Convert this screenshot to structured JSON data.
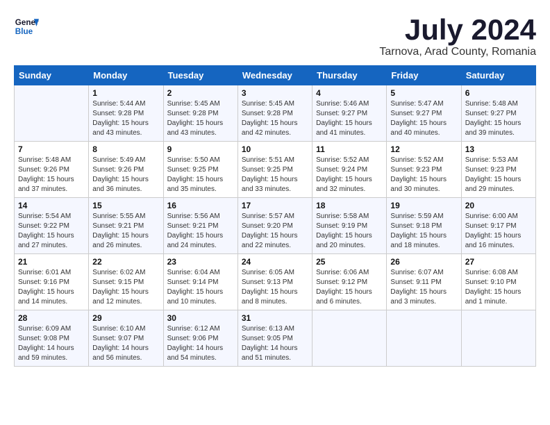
{
  "logo": {
    "line1": "General",
    "line2": "Blue"
  },
  "title": "July 2024",
  "subtitle": "Tarnova, Arad County, Romania",
  "days_header": [
    "Sunday",
    "Monday",
    "Tuesday",
    "Wednesday",
    "Thursday",
    "Friday",
    "Saturday"
  ],
  "weeks": [
    [
      {
        "day": "",
        "sunrise": "",
        "sunset": "",
        "daylight": ""
      },
      {
        "day": "1",
        "sunrise": "Sunrise: 5:44 AM",
        "sunset": "Sunset: 9:28 PM",
        "daylight": "Daylight: 15 hours and 43 minutes."
      },
      {
        "day": "2",
        "sunrise": "Sunrise: 5:45 AM",
        "sunset": "Sunset: 9:28 PM",
        "daylight": "Daylight: 15 hours and 43 minutes."
      },
      {
        "day": "3",
        "sunrise": "Sunrise: 5:45 AM",
        "sunset": "Sunset: 9:28 PM",
        "daylight": "Daylight: 15 hours and 42 minutes."
      },
      {
        "day": "4",
        "sunrise": "Sunrise: 5:46 AM",
        "sunset": "Sunset: 9:27 PM",
        "daylight": "Daylight: 15 hours and 41 minutes."
      },
      {
        "day": "5",
        "sunrise": "Sunrise: 5:47 AM",
        "sunset": "Sunset: 9:27 PM",
        "daylight": "Daylight: 15 hours and 40 minutes."
      },
      {
        "day": "6",
        "sunrise": "Sunrise: 5:48 AM",
        "sunset": "Sunset: 9:27 PM",
        "daylight": "Daylight: 15 hours and 39 minutes."
      }
    ],
    [
      {
        "day": "7",
        "sunrise": "Sunrise: 5:48 AM",
        "sunset": "Sunset: 9:26 PM",
        "daylight": "Daylight: 15 hours and 37 minutes."
      },
      {
        "day": "8",
        "sunrise": "Sunrise: 5:49 AM",
        "sunset": "Sunset: 9:26 PM",
        "daylight": "Daylight: 15 hours and 36 minutes."
      },
      {
        "day": "9",
        "sunrise": "Sunrise: 5:50 AM",
        "sunset": "Sunset: 9:25 PM",
        "daylight": "Daylight: 15 hours and 35 minutes."
      },
      {
        "day": "10",
        "sunrise": "Sunrise: 5:51 AM",
        "sunset": "Sunset: 9:25 PM",
        "daylight": "Daylight: 15 hours and 33 minutes."
      },
      {
        "day": "11",
        "sunrise": "Sunrise: 5:52 AM",
        "sunset": "Sunset: 9:24 PM",
        "daylight": "Daylight: 15 hours and 32 minutes."
      },
      {
        "day": "12",
        "sunrise": "Sunrise: 5:52 AM",
        "sunset": "Sunset: 9:23 PM",
        "daylight": "Daylight: 15 hours and 30 minutes."
      },
      {
        "day": "13",
        "sunrise": "Sunrise: 5:53 AM",
        "sunset": "Sunset: 9:23 PM",
        "daylight": "Daylight: 15 hours and 29 minutes."
      }
    ],
    [
      {
        "day": "14",
        "sunrise": "Sunrise: 5:54 AM",
        "sunset": "Sunset: 9:22 PM",
        "daylight": "Daylight: 15 hours and 27 minutes."
      },
      {
        "day": "15",
        "sunrise": "Sunrise: 5:55 AM",
        "sunset": "Sunset: 9:21 PM",
        "daylight": "Daylight: 15 hours and 26 minutes."
      },
      {
        "day": "16",
        "sunrise": "Sunrise: 5:56 AM",
        "sunset": "Sunset: 9:21 PM",
        "daylight": "Daylight: 15 hours and 24 minutes."
      },
      {
        "day": "17",
        "sunrise": "Sunrise: 5:57 AM",
        "sunset": "Sunset: 9:20 PM",
        "daylight": "Daylight: 15 hours and 22 minutes."
      },
      {
        "day": "18",
        "sunrise": "Sunrise: 5:58 AM",
        "sunset": "Sunset: 9:19 PM",
        "daylight": "Daylight: 15 hours and 20 minutes."
      },
      {
        "day": "19",
        "sunrise": "Sunrise: 5:59 AM",
        "sunset": "Sunset: 9:18 PM",
        "daylight": "Daylight: 15 hours and 18 minutes."
      },
      {
        "day": "20",
        "sunrise": "Sunrise: 6:00 AM",
        "sunset": "Sunset: 9:17 PM",
        "daylight": "Daylight: 15 hours and 16 minutes."
      }
    ],
    [
      {
        "day": "21",
        "sunrise": "Sunrise: 6:01 AM",
        "sunset": "Sunset: 9:16 PM",
        "daylight": "Daylight: 15 hours and 14 minutes."
      },
      {
        "day": "22",
        "sunrise": "Sunrise: 6:02 AM",
        "sunset": "Sunset: 9:15 PM",
        "daylight": "Daylight: 15 hours and 12 minutes."
      },
      {
        "day": "23",
        "sunrise": "Sunrise: 6:04 AM",
        "sunset": "Sunset: 9:14 PM",
        "daylight": "Daylight: 15 hours and 10 minutes."
      },
      {
        "day": "24",
        "sunrise": "Sunrise: 6:05 AM",
        "sunset": "Sunset: 9:13 PM",
        "daylight": "Daylight: 15 hours and 8 minutes."
      },
      {
        "day": "25",
        "sunrise": "Sunrise: 6:06 AM",
        "sunset": "Sunset: 9:12 PM",
        "daylight": "Daylight: 15 hours and 6 minutes."
      },
      {
        "day": "26",
        "sunrise": "Sunrise: 6:07 AM",
        "sunset": "Sunset: 9:11 PM",
        "daylight": "Daylight: 15 hours and 3 minutes."
      },
      {
        "day": "27",
        "sunrise": "Sunrise: 6:08 AM",
        "sunset": "Sunset: 9:10 PM",
        "daylight": "Daylight: 15 hours and 1 minute."
      }
    ],
    [
      {
        "day": "28",
        "sunrise": "Sunrise: 6:09 AM",
        "sunset": "Sunset: 9:08 PM",
        "daylight": "Daylight: 14 hours and 59 minutes."
      },
      {
        "day": "29",
        "sunrise": "Sunrise: 6:10 AM",
        "sunset": "Sunset: 9:07 PM",
        "daylight": "Daylight: 14 hours and 56 minutes."
      },
      {
        "day": "30",
        "sunrise": "Sunrise: 6:12 AM",
        "sunset": "Sunset: 9:06 PM",
        "daylight": "Daylight: 14 hours and 54 minutes."
      },
      {
        "day": "31",
        "sunrise": "Sunrise: 6:13 AM",
        "sunset": "Sunset: 9:05 PM",
        "daylight": "Daylight: 14 hours and 51 minutes."
      },
      {
        "day": "",
        "sunrise": "",
        "sunset": "",
        "daylight": ""
      },
      {
        "day": "",
        "sunrise": "",
        "sunset": "",
        "daylight": ""
      },
      {
        "day": "",
        "sunrise": "",
        "sunset": "",
        "daylight": ""
      }
    ]
  ]
}
